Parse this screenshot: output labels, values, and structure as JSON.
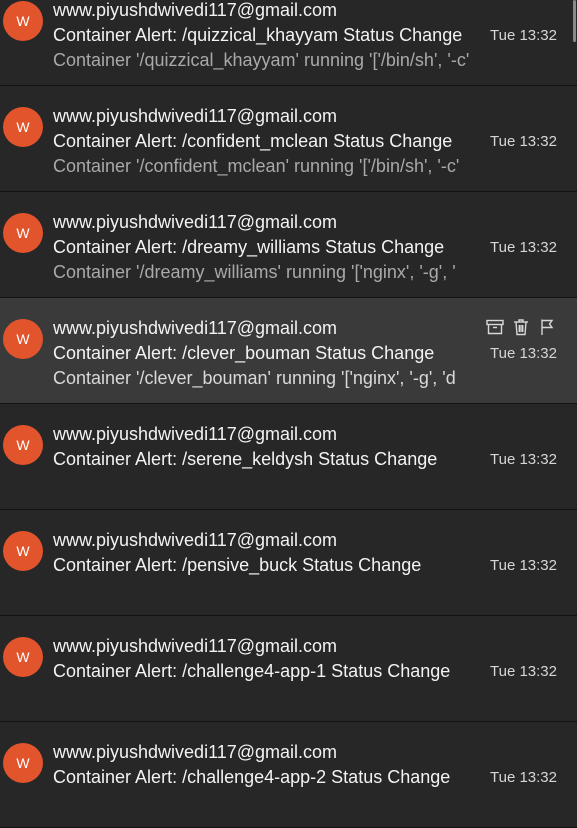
{
  "colors": {
    "avatar_bg": "#e1542c",
    "list_bg": "#272727",
    "hover_bg": "#3a3a3a"
  },
  "emails": [
    {
      "avatar": "W",
      "sender": "www.piyushdwivedi117@gmail.com",
      "subject": "Container Alert: /quizzical_khayyam Status Change",
      "preview": "Container '/quizzical_khayyam' running '['/bin/sh', '-c'",
      "time": "Tue 13:32"
    },
    {
      "avatar": "W",
      "sender": "www.piyushdwivedi117@gmail.com",
      "subject": "Container Alert: /confident_mclean Status Change",
      "preview": "Container '/confident_mclean' running '['/bin/sh', '-c'",
      "time": "Tue 13:32"
    },
    {
      "avatar": "W",
      "sender": "www.piyushdwivedi117@gmail.com",
      "subject": "Container Alert: /dreamy_williams Status Change",
      "preview": "Container '/dreamy_williams' running '['nginx', '-g', '",
      "time": "Tue 13:32"
    },
    {
      "avatar": "W",
      "sender": "www.piyushdwivedi117@gmail.com",
      "subject": "Container Alert: /clever_bouman Status Change",
      "preview": "Container '/clever_bouman' running '['nginx', '-g', 'd",
      "time": "Tue 13:32",
      "hovered": true,
      "actions": [
        "archive-icon",
        "trash-icon",
        "flag-icon"
      ]
    },
    {
      "avatar": "W",
      "sender": "www.piyushdwivedi117@gmail.com",
      "subject": "Container Alert: /serene_keldysh Status Change",
      "preview": "",
      "time": "Tue 13:32"
    },
    {
      "avatar": "W",
      "sender": "www.piyushdwivedi117@gmail.com",
      "subject": "Container Alert: /pensive_buck Status Change",
      "preview": "",
      "time": "Tue 13:32"
    },
    {
      "avatar": "W",
      "sender": "www.piyushdwivedi117@gmail.com",
      "subject": "Container Alert: /challenge4-app-1 Status Change",
      "preview": "",
      "time": "Tue 13:32"
    },
    {
      "avatar": "W",
      "sender": "www.piyushdwivedi117@gmail.com",
      "subject": "Container Alert: /challenge4-app-2 Status Change",
      "preview": "",
      "time": "Tue 13:32"
    }
  ]
}
